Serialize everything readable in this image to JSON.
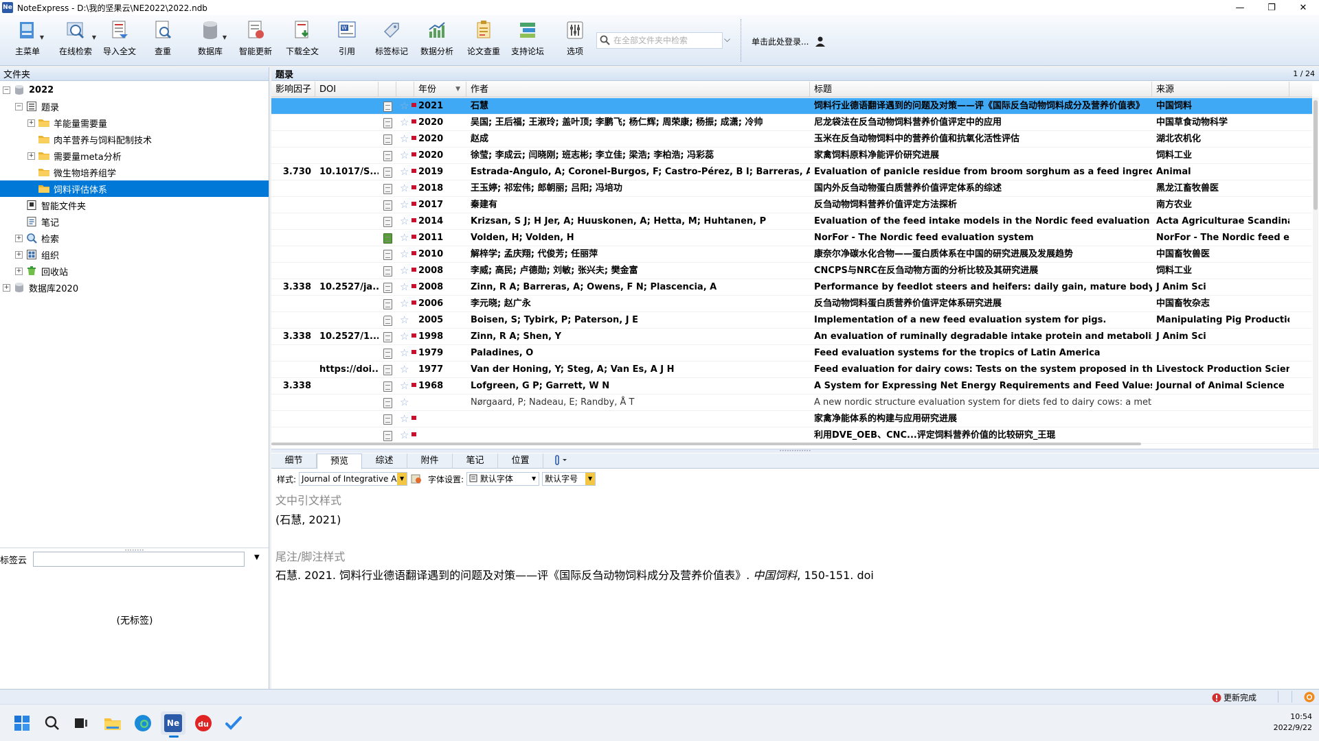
{
  "window": {
    "app_name": "NoteExpress",
    "title": "NoteExpress - D:\\我的坚果云\\NE2022\\2022.ndb",
    "minimize": "—",
    "maximize": "❐",
    "close": "✕"
  },
  "toolbar": {
    "items": [
      "主菜单",
      "在线检索",
      "导入全文",
      "查重",
      "数据库",
      "智能更新",
      "下载全文",
      "引用",
      "标签标记",
      "数据分析",
      "论文查重",
      "支持论坛",
      "选项"
    ],
    "search_placeholder": "在全部文件夹中检索",
    "login": "单击此处登录..."
  },
  "folders": {
    "header": "文件夹",
    "nodes": [
      {
        "label": "2022",
        "level": 0,
        "icon": "database-icon",
        "exp": "−",
        "bold": true
      },
      {
        "label": "题录",
        "level": 1,
        "icon": "list-icon",
        "exp": "−"
      },
      {
        "label": "羊能量需要量",
        "level": 2,
        "icon": "folder-icon",
        "exp": "+"
      },
      {
        "label": "肉羊营养与饲料配制技术",
        "level": 2,
        "icon": "folder-icon",
        "exp": ""
      },
      {
        "label": "需要量meta分析",
        "level": 2,
        "icon": "folder-icon",
        "exp": "+"
      },
      {
        "label": "微生物培养组学",
        "level": 2,
        "icon": "folder-icon",
        "exp": ""
      },
      {
        "label": "饲料评估体系",
        "level": 2,
        "icon": "folder-icon",
        "exp": "",
        "selected": true
      },
      {
        "label": "智能文件夹",
        "level": 1,
        "icon": "smart-folder-icon",
        "exp": ""
      },
      {
        "label": "笔记",
        "level": 1,
        "icon": "notes-icon",
        "exp": ""
      },
      {
        "label": "检索",
        "level": 1,
        "icon": "search-icon",
        "exp": "+"
      },
      {
        "label": "组织",
        "level": 1,
        "icon": "organize-icon",
        "exp": "+"
      },
      {
        "label": "回收站",
        "level": 1,
        "icon": "recycle-bin-icon",
        "exp": "+"
      },
      {
        "label": "数据库2020",
        "level": 0,
        "icon": "database-icon",
        "exp": "+"
      }
    ]
  },
  "tags": {
    "label": "标签云",
    "empty": "(无标签)"
  },
  "records": {
    "header": "题录",
    "page": "1 / 24",
    "columns": [
      "影响因子",
      "DOI",
      "",
      "",
      "年份",
      "作者",
      "标题",
      "来源"
    ],
    "rows": [
      {
        "if": "",
        "doi": "",
        "year": "2021",
        "author": "石慧",
        "title": "饲料行业德语翻译遇到的问题及对策——评《国际反刍动物饲料成分及营养价值表》",
        "source": "中国饲料",
        "flag": true,
        "doc": "normal",
        "selected": true
      },
      {
        "if": "",
        "doi": "",
        "year": "2020",
        "author": "吴国; 王后福; 王淑玲; 盖叶顶; 李鹏飞; 杨仁辉; 周荣康; 杨振; 成潇; 冷帅",
        "title": "尼龙袋法在反刍动物饲料营养价值评定中的应用",
        "source": "中国草食动物科学",
        "flag": true,
        "doc": "normal"
      },
      {
        "if": "",
        "doi": "",
        "year": "2020",
        "author": "赵成",
        "title": "玉米在反刍动物饲料中的营养价值和抗氧化活性评估",
        "source": "湖北农机化",
        "flag": true,
        "doc": "normal"
      },
      {
        "if": "",
        "doi": "",
        "year": "2020",
        "author": "徐莹; 李成云; 闫晓刚; 班志彬; 李立佳; 梁浩; 李柏浩; 冯彩蕊",
        "title": "家禽饲料原料净能评价研究进展",
        "source": "饲料工业",
        "flag": true,
        "doc": "normal"
      },
      {
        "if": "3.730",
        "doi": "10.1017/S...",
        "year": "2019",
        "author": "Estrada-Angulo, A; Coronel-Burgos, F; Castro-Pérez, B I; Barreras, A; Zinn",
        "title": "Evaluation of panicle residue from broom sorghum as a feed ingredient in",
        "source": "Animal",
        "flag": true,
        "doc": "normal"
      },
      {
        "if": "",
        "doi": "",
        "year": "2018",
        "author": "王玉婷; 祁宏伟; 郎朝丽; 吕阳; 冯培功",
        "title": "国内外反刍动物蛋白质营养价值评定体系的综述",
        "source": "黑龙江畜牧兽医",
        "flag": true,
        "doc": "normal"
      },
      {
        "if": "",
        "doi": "",
        "year": "2017",
        "author": "秦建有",
        "title": "反刍动物饲料营养价值评定方法探析",
        "source": "南方农业",
        "flag": true,
        "doc": "normal"
      },
      {
        "if": "",
        "doi": "",
        "year": "2014",
        "author": "Krizsan, S J; H Jer, A; Huuskonen, A; Hetta, M; Huhtanen, P",
        "title": "Evaluation of the feed intake models in the Nordic feed evaluation system",
        "source": "Acta Agriculturae Scandinavi",
        "flag": true,
        "doc": "normal"
      },
      {
        "if": "",
        "doi": "",
        "year": "2011",
        "author": "Volden, H; Volden, H",
        "title": "NorFor - The Nordic feed evaluation system",
        "source": "NorFor - The Nordic feed ev",
        "flag": true,
        "doc": "green"
      },
      {
        "if": "",
        "doi": "",
        "year": "2010",
        "author": "解梓学; 孟庆翔; 代俊芳; 任丽萍",
        "title": "康奈尔净碳水化合物——蛋白质体系在中国的研究进展及发展趋势",
        "source": "中国畜牧兽医",
        "flag": true,
        "doc": "normal"
      },
      {
        "if": "",
        "doi": "",
        "year": "2008",
        "author": "李威; 高民; 卢德勋; 刘敏; 张兴夫; 樊金富",
        "title": "CNCPS与NRC在反刍动物方面的分析比较及其研究进展",
        "source": "饲料工业",
        "flag": true,
        "doc": "normal"
      },
      {
        "if": "3.338",
        "doi": "10.2527/ja...",
        "year": "2008",
        "author": "Zinn, R A; Barreras, A; Owens, F N; Plascencia, A",
        "title": "Performance by feedlot steers and heifers: daily gain, mature body weigh",
        "source": "J Anim Sci",
        "flag": true,
        "doc": "normal"
      },
      {
        "if": "",
        "doi": "",
        "year": "2006",
        "author": "李元晓; 赵广永",
        "title": "反刍动物饲料蛋白质营养价值评定体系研究进展",
        "source": "中国畜牧杂志",
        "flag": true,
        "doc": "normal"
      },
      {
        "if": "",
        "doi": "",
        "year": "2005",
        "author": "Boisen, S; Tybirk, P; Paterson, J E",
        "title": "Implementation of a new feed evaluation system for pigs.",
        "source": "Manipulating Pig Production",
        "flag": false,
        "doc": "open"
      },
      {
        "if": "3.338",
        "doi": "10.2527/1...",
        "year": "1998",
        "author": "Zinn, R A; Shen, Y",
        "title": "An evaluation of ruminally degradable intake protein and metabolizable",
        "source": "J Anim Sci",
        "flag": true,
        "doc": "normal"
      },
      {
        "if": "",
        "doi": "",
        "year": "1979",
        "author": "Paladines, O",
        "title": "Feed evaluation systems for the tropics of Latin America",
        "source": "",
        "flag": true,
        "doc": "normal"
      },
      {
        "if": "",
        "doi": "https://doi...",
        "year": "1977",
        "author": "Van der Honing, Y; Steg, A; Van Es, A J H",
        "title": "Feed evaluation for dairy cows: Tests on the system proposed in the Neth",
        "source": "Livestock Production Science",
        "flag": false,
        "doc": "normal"
      },
      {
        "if": "3.338",
        "doi": "",
        "year": "1968",
        "author": "Lofgreen, G P; Garrett, W N",
        "title": "A System for Expressing Net Energy Requirements and Feed Values for Gr",
        "source": "Journal of Animal Science",
        "flag": true,
        "doc": "normal"
      },
      {
        "if": "",
        "doi": "",
        "year": "",
        "author": "Nørgaard, P; Nadeau, E; Randby, Å T",
        "title": "A new nordic structure evaluation system for diets fed to dairy cows: a meta ...",
        "source": "",
        "flag": false,
        "doc": "normal",
        "light": true
      },
      {
        "if": "",
        "doi": "",
        "year": "",
        "author": "",
        "title": "家禽净能体系的构建与应用研究进展",
        "source": "",
        "flag": true,
        "doc": "normal"
      },
      {
        "if": "",
        "doi": "",
        "year": "",
        "author": "",
        "title": "利用DVE_OEB、CNC...评定饲料营养价值的比较研究_王琨",
        "source": "",
        "flag": true,
        "doc": "normal"
      }
    ]
  },
  "detail_tabs": [
    "细节",
    "预览",
    "综述",
    "附件",
    "笔记",
    "位置"
  ],
  "active_tab": 1,
  "style_options": {
    "style_label": "样式:",
    "style_value": "Journal of Integrative A",
    "font_label": "字体设置:",
    "font_value": "默认字体",
    "size_value": "默认字号"
  },
  "preview": {
    "intext_heading": "文中引文样式",
    "intext": "(石慧, 2021)",
    "footnote_heading": "尾注/脚注样式",
    "footnote_pre": "石慧. 2021. 饲料行业德语翻译遇到的问题及对策——评《国际反刍动物饲料成分及营养价值表》. ",
    "footnote_journal": "中国饲料",
    "footnote_post": ", 150-151. doi"
  },
  "status": {
    "update": "更新完成"
  },
  "taskbar": {
    "time": "10:54",
    "date": "2022/9/22",
    "apps": [
      "start-icon",
      "search-icon",
      "task-view-icon",
      "file-explorer-icon",
      "edge-icon",
      "noteexpress-icon",
      "app-red-icon",
      "todo-icon"
    ]
  },
  "colors": {
    "accent": "#0078d7",
    "row_selected": "#3fa9f5",
    "flag": "#c8102e"
  }
}
